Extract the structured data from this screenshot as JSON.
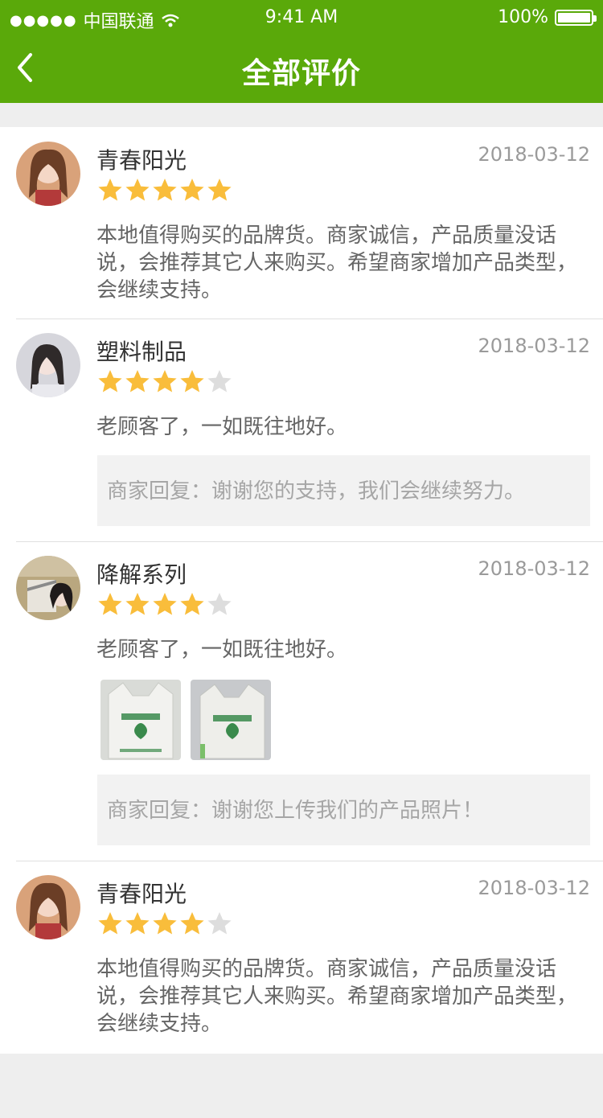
{
  "status_bar": {
    "signal_dots": "●●●●●",
    "carrier": "中国联通",
    "time": "9:41 AM",
    "battery": "100%"
  },
  "nav": {
    "title": "全部评价"
  },
  "reviews": [
    {
      "name": "青春阳光",
      "date": "2018-03-12",
      "stars": 5,
      "text": "本地值得购买的品牌货。商家诚信，产品质量没话说，会推荐其它人来购买。希望商家增加产品类型，会继续支持。"
    },
    {
      "name": "塑料制品",
      "date": "2018-03-12",
      "stars": 4,
      "text": "老顾客了，一如既往地好。",
      "reply": "商家回复：谢谢您的支持，我们会继续努力。"
    },
    {
      "name": "降解系列",
      "date": "2018-03-12",
      "stars": 4,
      "text": "老顾客了，一如既往地好。",
      "reply": "商家回复：谢谢您上传我们的产品照片！"
    },
    {
      "name": "青春阳光",
      "date": "2018-03-12",
      "stars": 4,
      "text": "本地值得购买的品牌货。商家诚信，产品质量没话说，会推荐其它人来购买。希望商家增加产品类型，会继续支持。"
    }
  ],
  "colors": {
    "header": "#5aa90a",
    "star_on": "#f9bd3b",
    "star_off": "#dddddd"
  }
}
